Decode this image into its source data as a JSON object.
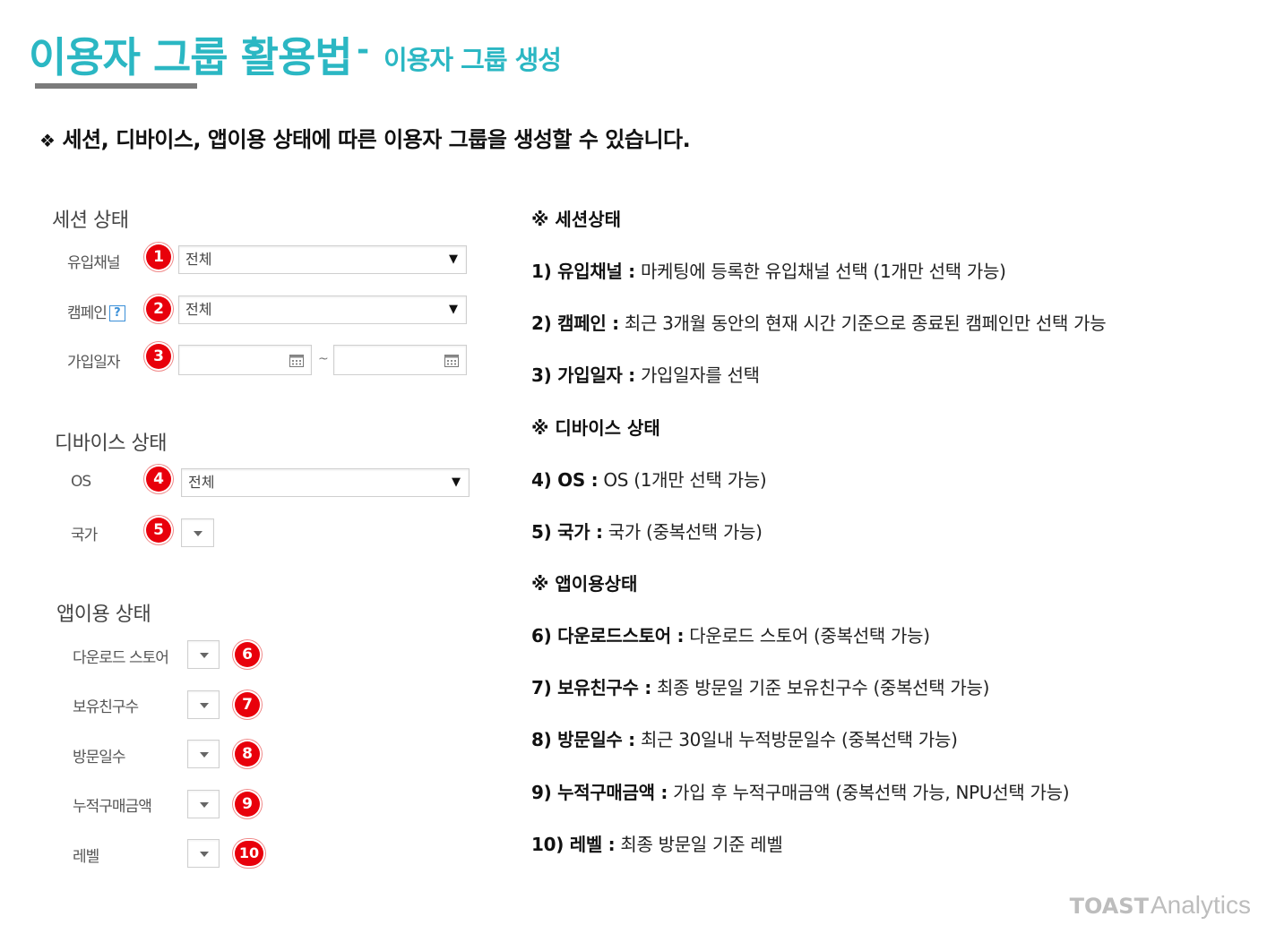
{
  "header": {
    "title": "이용자 그룹 활용법",
    "separator": "-",
    "subtitle": "이용자 그룹 생성"
  },
  "intro": {
    "bullet": "❖",
    "text": "세션, 디바이스, 앱이용 상태에 따른 이용자 그룹을 생성할 수 있습니다."
  },
  "form": {
    "session": {
      "title": "세션 상태",
      "inflow_label": "유입채널",
      "inflow_value": "전체",
      "campaign_label": "캠페인",
      "campaign_help": "?",
      "campaign_value": "전체",
      "join_date_label": "가입일자",
      "date_separator": "~"
    },
    "device": {
      "title": "디바이스 상태",
      "os_label": "OS",
      "os_value": "전체",
      "country_label": "국가"
    },
    "app": {
      "title": "앱이용 상태",
      "download_store_label": "다운로드 스토어",
      "friends_label": "보유친구수",
      "visit_days_label": "방문일수",
      "purchase_label": "누적구매금액",
      "level_label": "레벨"
    },
    "badges": [
      "1",
      "2",
      "3",
      "4",
      "5",
      "6",
      "7",
      "8",
      "9",
      "10"
    ]
  },
  "descriptions": {
    "session_head": "※ 세션상태",
    "item1_key": "1) 유입채널 :",
    "item1_text": " 마케팅에 등록한 유입채널 선택 (1개만 선택 가능)",
    "item2_key": "2) 캠페인 :",
    "item2_text": " 최근 3개월 동안의 현재 시간 기준으로 종료된 캠페인만 선택 가능",
    "item3_key": "3) 가입일자 :",
    "item3_text": " 가입일자를 선택",
    "device_head": "※ 디바이스 상태",
    "item4_key": "4) OS :",
    "item4_text": " OS (1개만 선택 가능)",
    "item5_key": "5) 국가 :",
    "item5_text": " 국가 (중복선택 가능)",
    "app_head": "※ 앱이용상태",
    "item6_key": "6) 다운로드스토어 :",
    "item6_text": " 다운로드 스토어 (중복선택 가능)",
    "item7_key": "7) 보유친구수 :",
    "item7_text": " 최종 방문일 기준 보유친구수 (중복선택 가능)",
    "item8_key": "8) 방문일수 :",
    "item8_text": " 최근 30일내 누적방문일수 (중복선택 가능)",
    "item9_key": "9) 누적구매금액 :",
    "item9_text": " 가입 후 누적구매금액 (중복선택 가능, NPU선택 가능)",
    "item10_key": "10) 레벨 :",
    "item10_text": " 최종 방문일 기준 레벨"
  },
  "footer": {
    "logo_toast": "TOAST",
    "logo_analytics": "Analytics"
  },
  "colors": {
    "accent": "#2bb7c3",
    "badge": "#e8000b",
    "underline": "#7b7b7b"
  }
}
